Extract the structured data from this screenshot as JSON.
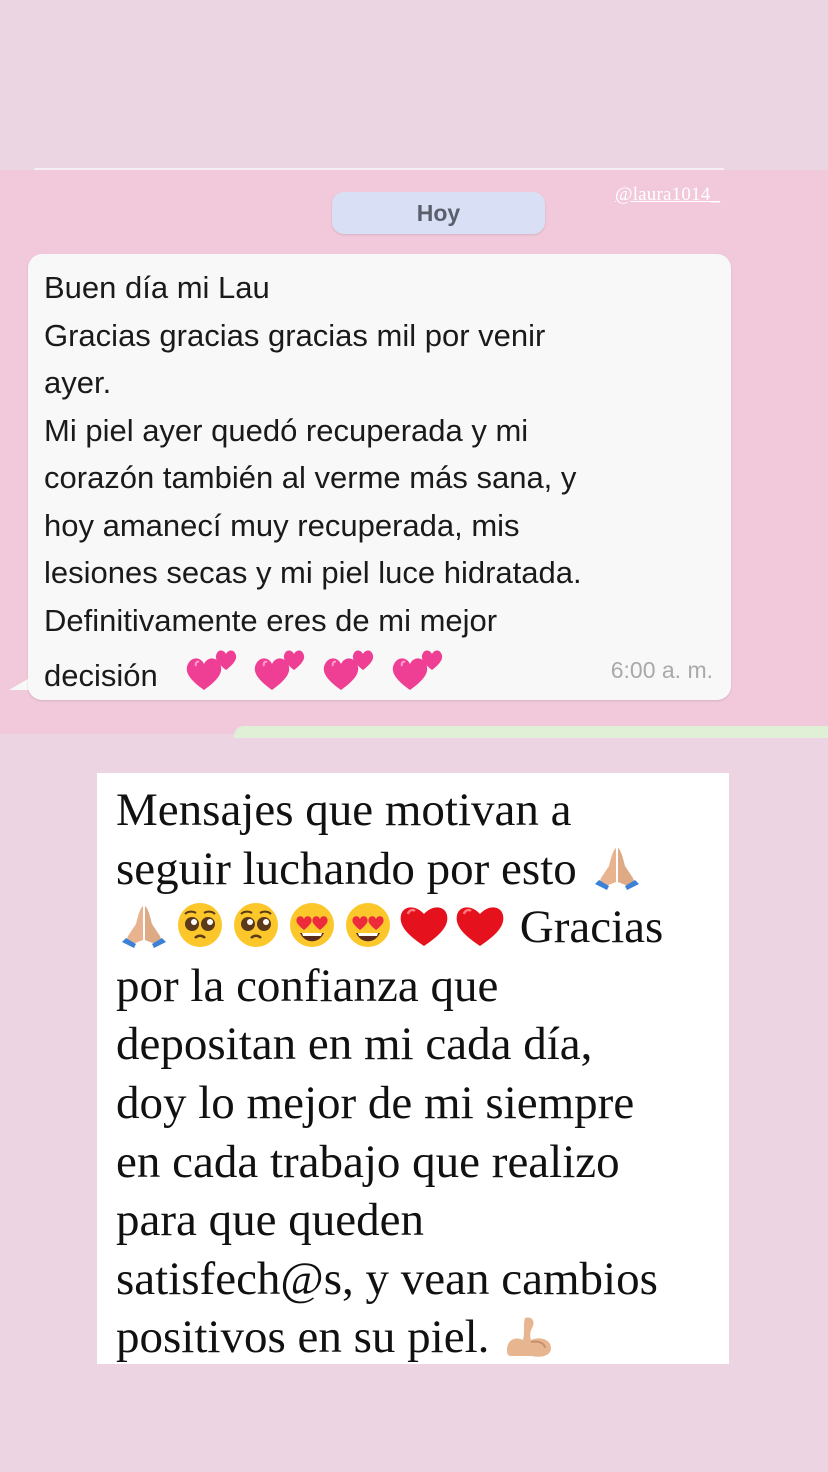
{
  "chat": {
    "date_label": "Hoy",
    "mention": "@laura1014_",
    "message": {
      "lines": [
        "Buen día mi Lau",
        "Gracias gracias gracias mil por venir",
        "ayer.",
        "Mi piel ayer quedó recuperada y mi",
        "corazón también al verme más sana, y",
        "hoy amanecí muy recuperada, mis",
        "lesiones secas y mi piel luce hidratada.",
        "Definitivamente eres de mi mejor",
        "decisión"
      ],
      "emoji": [
        "two-hearts-icon",
        "two-hearts-icon",
        "two-hearts-icon",
        "two-hearts-icon"
      ],
      "time": "6:00 a. m."
    }
  },
  "caption": {
    "line1": "Mensajes que motivan a",
    "line2": "seguir luchando por esto",
    "line3_text": "Gracias",
    "line4": "por la confianza que",
    "line5": "depositan en mi cada día,",
    "line6": "doy lo mejor de mi siempre",
    "line7": "en cada trabajo que realizo",
    "line8": "para que queden",
    "line9": "satisfech@s, y vean cambios",
    "line10": "positivos en su piel.",
    "emoji": [
      "folded-hands-icon",
      "folded-hands-icon",
      "pleading-face-icon",
      "pleading-face-icon",
      "heart-eyes-face-icon",
      "heart-eyes-face-icon",
      "red-heart-icon",
      "red-heart-icon",
      "flexed-biceps-icon"
    ]
  },
  "colors": {
    "background": "#ecd4e3",
    "chat_background": "#f1c9da",
    "bubble": "#f8f8f8",
    "date_pill": "#d9dff4",
    "caption_box": "#ffffff",
    "heart_pink": "#ef3f95"
  }
}
